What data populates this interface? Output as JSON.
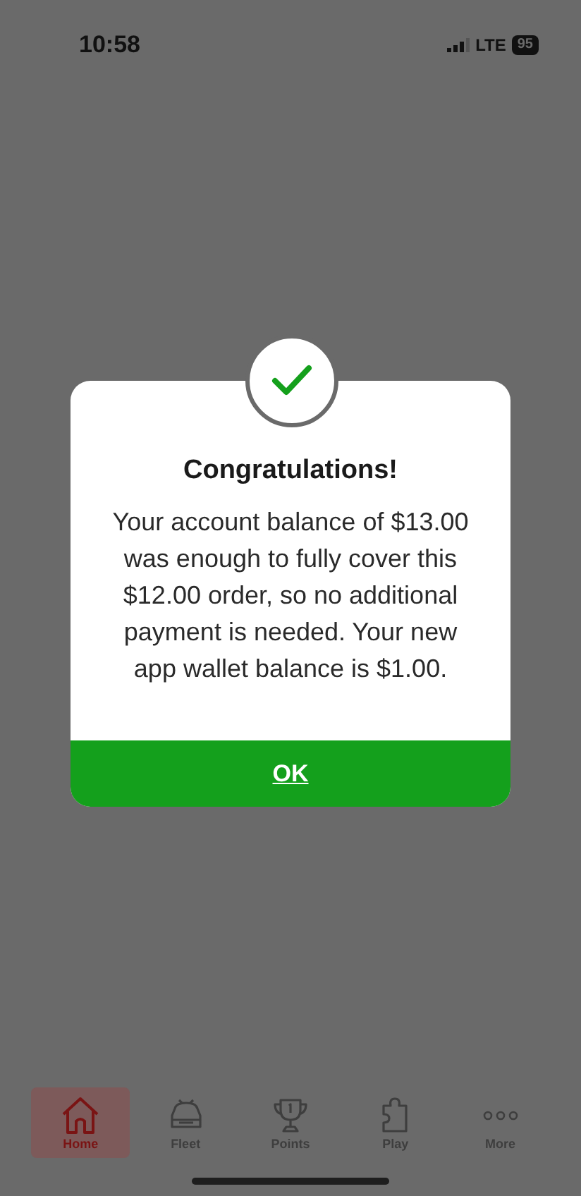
{
  "status_bar": {
    "time": "10:58",
    "network": "LTE",
    "battery": "95"
  },
  "dialog": {
    "title": "Congratulations!",
    "message": "Your account balance of $13.00 was enough to fully cover this $12.00 order, so no additional payment is needed. Your new app wallet balance is $1.00.",
    "button": "OK"
  },
  "tab_bar": [
    {
      "label": "Home",
      "kind": "house",
      "selected": true
    },
    {
      "label": "Fleet",
      "kind": "car",
      "selected": false
    },
    {
      "label": "Points",
      "kind": "trophy",
      "selected": false
    },
    {
      "label": "Play",
      "kind": "puzzle",
      "selected": false
    },
    {
      "label": "More",
      "kind": "dots",
      "selected": false
    }
  ]
}
